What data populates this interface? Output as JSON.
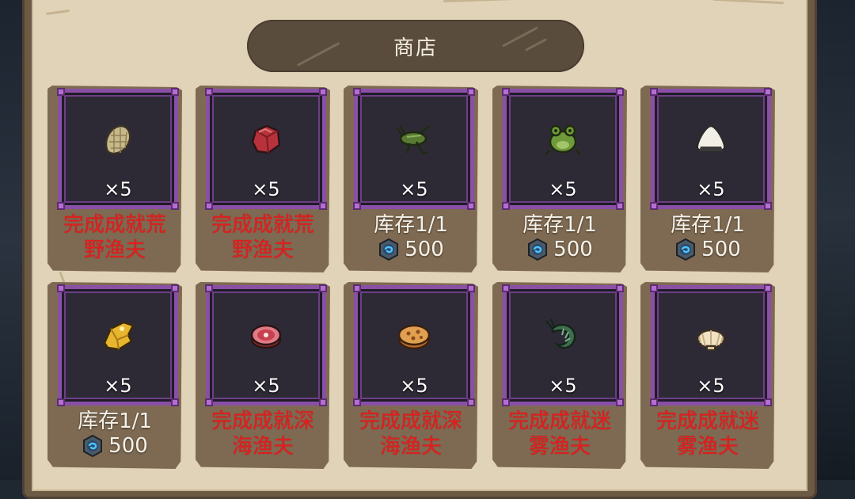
{
  "shop": {
    "title": "商店"
  },
  "items": [
    {
      "icon": "fish-scale-icon",
      "qty": "×5",
      "line1": "完成成就荒",
      "line2": "野渔夫",
      "locked": true
    },
    {
      "icon": "raw-meat-icon",
      "qty": "×5",
      "line1": "完成成就荒",
      "line2": "野渔夫",
      "locked": true
    },
    {
      "icon": "cricket-icon",
      "qty": "×5",
      "line1": "库存1/1",
      "price": "500",
      "locked": false
    },
    {
      "icon": "frog-icon",
      "qty": "×5",
      "line1": "库存1/1",
      "price": "500",
      "locked": false
    },
    {
      "icon": "rice-ball-icon",
      "qty": "×5",
      "line1": "库存1/1",
      "price": "500",
      "locked": false
    },
    {
      "icon": "golden-shell-icon",
      "qty": "×5",
      "line1": "库存1/1",
      "price": "500",
      "locked": false
    },
    {
      "icon": "steak-icon",
      "qty": "×5",
      "line1": "完成成就深",
      "line2": "海渔夫",
      "locked": true
    },
    {
      "icon": "cookie-icon",
      "qty": "×5",
      "line1": "完成成就深",
      "line2": "海渔夫",
      "locked": true
    },
    {
      "icon": "shrimp-icon",
      "qty": "×5",
      "line1": "完成成就迷",
      "line2": "雾渔夫",
      "locked": true
    },
    {
      "icon": "scallop-icon",
      "qty": "×5",
      "line1": "完成成就迷",
      "line2": "雾渔夫",
      "locked": true
    }
  ],
  "currency_icon": "gem-coin-icon",
  "colors": {
    "locked_text": "#e01f1f",
    "normal_text": "#f6f2ea",
    "slot_border": "#8a4fa6",
    "panel": "#e1d3b7",
    "card": "#7e6a52"
  }
}
